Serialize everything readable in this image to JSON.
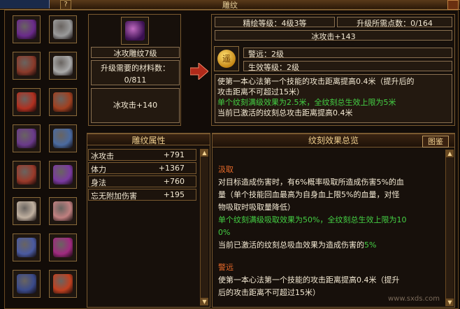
{
  "window": {
    "title": "雕纹",
    "help_label": "?"
  },
  "left_slots": [
    {
      "icon": "purple-firework-icon",
      "color": "#6a2a8a"
    },
    {
      "icon": "silver-ring-icon",
      "color": "#9a9a9a"
    },
    {
      "icon": "beast-mask-icon",
      "color": "#8a3a2a"
    },
    {
      "icon": "silver-ring-icon",
      "color": "#aaaaaa"
    },
    {
      "icon": "red-scroll-icon",
      "color": "#b03020"
    },
    {
      "icon": "red-tube-icon",
      "color": "#a04020"
    },
    {
      "icon": "purple-amulet-icon",
      "color": "#6a3a8a"
    },
    {
      "icon": "blue-needle-icon",
      "color": "#4a6aa0"
    },
    {
      "icon": "red-belt-icon",
      "color": "#9a3a2a"
    },
    {
      "icon": "purple-sword-icon",
      "color": "#7a3aa0"
    },
    {
      "icon": "jade-pendant-icon",
      "color": "#c0b0a0"
    },
    {
      "icon": "pearl-string-icon",
      "color": "#c08080"
    },
    {
      "icon": "blue-gem-icon",
      "color": "#4a5aa0"
    },
    {
      "icon": "purple-orb-icon",
      "color": "#a02a80"
    },
    {
      "icon": "blue-boots-icon",
      "color": "#3a4a8a"
    },
    {
      "icon": "fire-gem-icon",
      "color": "#c04020"
    }
  ],
  "item_panel": {
    "item_icon": "ice-carving-icon",
    "name": "冰攻雕纹7级",
    "material_label": "升级需要的材料数：",
    "material_value": "0/811",
    "current_effect": "冰攻击+140"
  },
  "upgrade_panel": {
    "refine_level": "精绘等级：4级3等",
    "points_needed": "升级所需点数：0/164",
    "next_effect": "冰攻击+143",
    "skill_icon": "gold-coin-icon",
    "skill_icon_char": "遥",
    "skill_name": "警远：2级",
    "effect_level": "生效等级：2级",
    "desc_white": "使第一本心法第一个技能的攻击距离提高0.4米（提升后的",
    "desc_white2": "攻击距离不可超过15米）",
    "desc_green": "单个纹刻满级效果为2.5米，全纹刻总生效上限为5米",
    "desc_active": "当前已激活的纹刻总攻击距离提高0.4米"
  },
  "attributes": {
    "header": "雕纹属性",
    "rows": [
      {
        "name": "冰攻击",
        "value": "+791"
      },
      {
        "name": "体力",
        "value": "+1367"
      },
      {
        "name": "身法",
        "value": "+760"
      },
      {
        "name": "忘无附加伤害",
        "value": "+195"
      }
    ]
  },
  "overview": {
    "header": "纹刻效果总览",
    "button": "图鉴",
    "blocks": [
      {
        "title": "汲取",
        "lines_white": [
          "对目标造成伤害时，有6%概率吸取所造成伤害5%的血",
          "量（单个技能回血最高为自身血上限5%的血量，对怪",
          "物吸取时吸取量降低）"
        ],
        "lines_green": [
          "单个纹刻满级吸取效果为50%，全纹刻总生效上限为10",
          "0%"
        ],
        "active_prefix": "当前已激活的纹刻总吸血效果为造成伤害的",
        "active_value": "5%"
      },
      {
        "title": "警远",
        "lines_white": [
          "使第一本心法第一个技能的攻击距离提高0.4米（提升",
          "后的攻击距离不可超过15米）"
        ]
      }
    ]
  },
  "watermark": "www.sxds.com"
}
